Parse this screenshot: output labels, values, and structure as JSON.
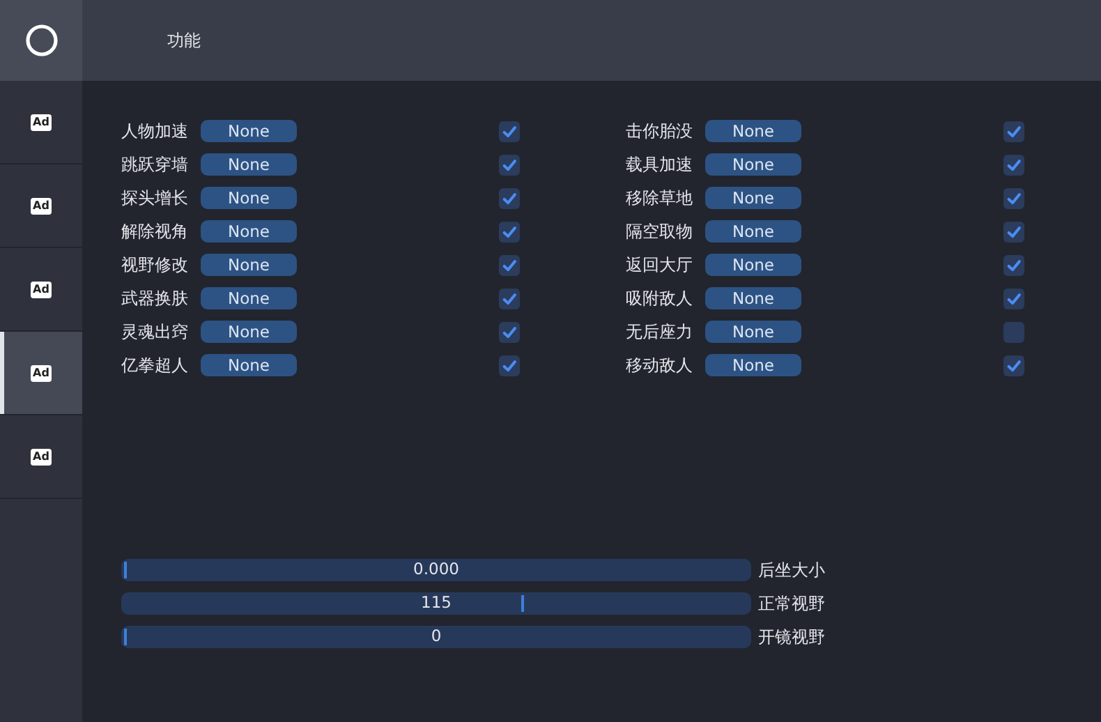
{
  "sidebar": {
    "tabs": [
      {
        "label": "Ad",
        "selected": false
      },
      {
        "label": "Ad",
        "selected": false
      },
      {
        "label": "Ad",
        "selected": false
      },
      {
        "label": "Ad",
        "selected": true
      },
      {
        "label": "Ad",
        "selected": false
      }
    ]
  },
  "header": {
    "title": "功能"
  },
  "features": [
    {
      "label": "人物加速",
      "key": "None",
      "checked": true
    },
    {
      "label": "跳跃穿墙",
      "key": "None",
      "checked": true
    },
    {
      "label": "探头增长",
      "key": "None",
      "checked": true
    },
    {
      "label": "解除视角",
      "key": "None",
      "checked": true
    },
    {
      "label": "视野修改",
      "key": "None",
      "checked": true
    },
    {
      "label": "武器换肤",
      "key": "None",
      "checked": true
    },
    {
      "label": "灵魂出窍",
      "key": "None",
      "checked": true
    },
    {
      "label": "亿拳超人",
      "key": "None",
      "checked": true
    },
    {
      "label": "击你胎没",
      "key": "None",
      "checked": true
    },
    {
      "label": "载具加速",
      "key": "None",
      "checked": true
    },
    {
      "label": "移除草地",
      "key": "None",
      "checked": true
    },
    {
      "label": "隔空取物",
      "key": "None",
      "checked": true
    },
    {
      "label": "返回大厅",
      "key": "None",
      "checked": true
    },
    {
      "label": "吸附敌人",
      "key": "None",
      "checked": true
    },
    {
      "label": "无后座力",
      "key": "None",
      "checked": false
    },
    {
      "label": "移动敌人",
      "key": "None",
      "checked": true
    }
  ],
  "sliders": [
    {
      "label": "后坐大小",
      "value": "0.000",
      "level": 0
    },
    {
      "label": "正常视野",
      "value": "115",
      "level": 0.64
    },
    {
      "label": "开镜视野",
      "value": "0",
      "level": 0
    }
  ]
}
